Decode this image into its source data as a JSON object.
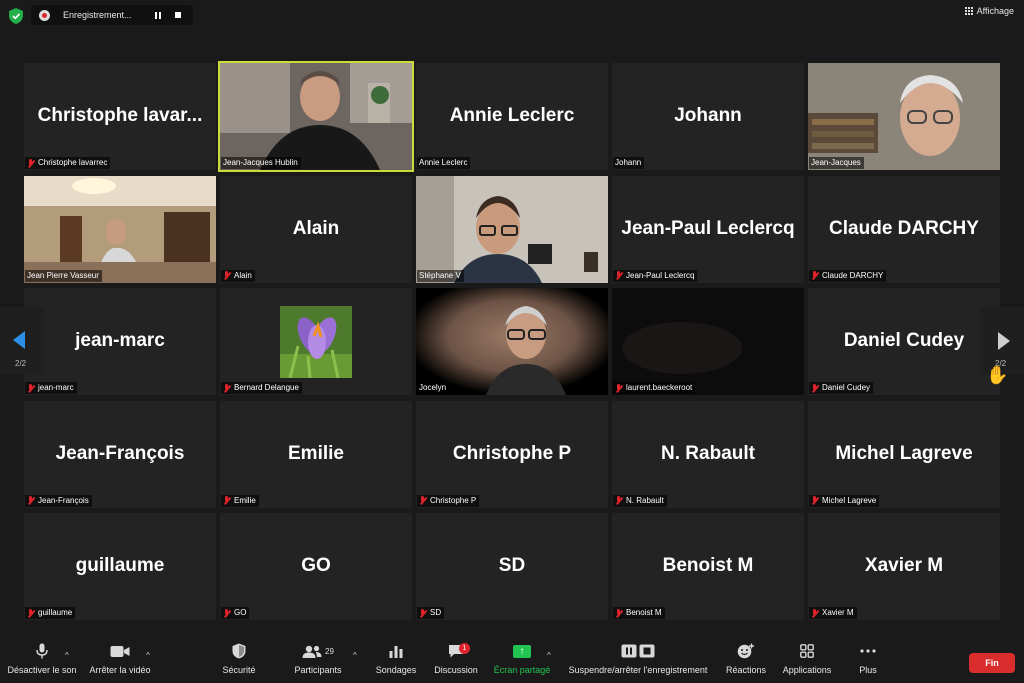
{
  "topbar": {
    "recording_label": "Enregistrement...",
    "view_label": "Affichage"
  },
  "participants": [
    {
      "big": "Christophe  lavar...",
      "name": "Christophe lavarrec",
      "video": false,
      "muted": true
    },
    {
      "big": "",
      "name": "Jean-Jacques Hublin",
      "video": true,
      "muted": false,
      "active": true
    },
    {
      "big": "Annie Leclerc",
      "name": "Annie Leclerc",
      "video": false,
      "muted": false
    },
    {
      "big": "Johann",
      "name": "Johann",
      "video": false,
      "muted": false
    },
    {
      "big": "",
      "name": "Jean-Jacques",
      "video": true,
      "muted": false
    },
    {
      "big": "",
      "name": "Jean Pierre Vasseur",
      "video": true,
      "muted": false
    },
    {
      "big": "Alain",
      "name": "Alain",
      "video": false,
      "muted": true
    },
    {
      "big": "",
      "name": "Stéphane V",
      "video": true,
      "muted": false
    },
    {
      "big": "Jean-Paul Leclercq",
      "name": "Jean-Paul Leclercq",
      "video": false,
      "muted": true
    },
    {
      "big": "Claude DARCHY",
      "name": "Claude DARCHY",
      "video": false,
      "muted": true
    },
    {
      "big": "jean-marc",
      "name": "jean-marc",
      "video": false,
      "muted": true
    },
    {
      "big": "",
      "name": "Bernard Delangue",
      "video": false,
      "muted": true,
      "avatar": "crocus-flower"
    },
    {
      "big": "",
      "name": "Jocelyn",
      "video": true,
      "muted": false
    },
    {
      "big": "",
      "name": "laurent.baeckeroot",
      "video": true,
      "muted": true
    },
    {
      "big": "Daniel Cudey",
      "name": "Daniel Cudey",
      "video": false,
      "muted": true
    },
    {
      "big": "Jean-François",
      "name": "Jean-François",
      "video": false,
      "muted": true
    },
    {
      "big": "Emilie",
      "name": "Emilie",
      "video": false,
      "muted": true
    },
    {
      "big": "Christophe P",
      "name": "Christophe P",
      "video": false,
      "muted": true
    },
    {
      "big": "N. Rabault",
      "name": "N. Rabault",
      "video": false,
      "muted": true
    },
    {
      "big": "Michel Lagreve",
      "name": "Michel Lagreve",
      "video": false,
      "muted": true
    },
    {
      "big": "guillaume",
      "name": "guillaume",
      "video": false,
      "muted": true
    },
    {
      "big": "GO",
      "name": "GO",
      "video": false,
      "muted": true
    },
    {
      "big": "SD",
      "name": "SD",
      "video": false,
      "muted": true
    },
    {
      "big": "Benoist M",
      "name": "Benoist M",
      "video": false,
      "muted": true
    },
    {
      "big": "Xavier M",
      "name": "Xavier M",
      "video": false,
      "muted": true
    }
  ],
  "pager": {
    "left": "2/2",
    "right": "2/2"
  },
  "toolbar": {
    "mute": "Désactiver le son",
    "video": "Arrêter la vidéo",
    "security": "Sécurité",
    "participants": "Participants",
    "participants_count": "29",
    "polls": "Sondages",
    "chat": "Discussion",
    "chat_badge": "1",
    "share": "Écran partagé",
    "record": "Suspendre/arrêter l'enregistrement",
    "reactions": "Réactions",
    "apps": "Applications",
    "more": "Plus",
    "end": "Fin"
  },
  "colors": {
    "active_border": "#c9dc3a",
    "share_green": "#23c552",
    "end_red": "#d92c2c",
    "muted_red": "#e0242b",
    "nav_blue": "#2c8fe8"
  }
}
